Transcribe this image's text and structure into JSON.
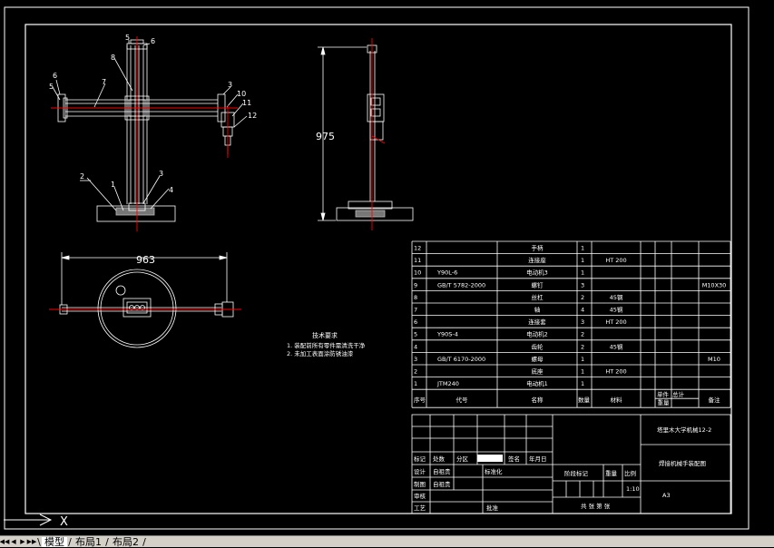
{
  "view_labels": {
    "dim_height": "975",
    "dim_width": "963"
  },
  "balloons": [
    "5",
    "6",
    "8",
    "7",
    "6",
    "5",
    "3",
    "10",
    "11",
    "12",
    "2",
    "1",
    "3",
    "4"
  ],
  "tech_notes": {
    "title": "技术要求",
    "lines": [
      "1. 装配前所有零件需清洗干净",
      "2. 未加工表面涂防锈油漆"
    ]
  },
  "bom": {
    "rows": [
      {
        "no": "12",
        "code": "",
        "name": "手柄",
        "qty": "1",
        "mat": "",
        "note": ""
      },
      {
        "no": "11",
        "code": "",
        "name": "连接座",
        "qty": "1",
        "mat": "HT 200",
        "note": ""
      },
      {
        "no": "10",
        "code": "Y90L-6",
        "name": "电动机3",
        "qty": "1",
        "mat": "",
        "note": ""
      },
      {
        "no": "9",
        "code": "GB/T 5782-2000",
        "name": "螺钉",
        "qty": "3",
        "mat": "",
        "note": "M10X30"
      },
      {
        "no": "8",
        "code": "",
        "name": "丝杠",
        "qty": "2",
        "mat": "45钢",
        "note": ""
      },
      {
        "no": "7",
        "code": "",
        "name": "轴",
        "qty": "4",
        "mat": "45钢",
        "note": ""
      },
      {
        "no": "6",
        "code": "",
        "name": "连接套",
        "qty": "3",
        "mat": "HT 200",
        "note": ""
      },
      {
        "no": "5",
        "code": "Y90S-4",
        "name": "电动机2",
        "qty": "2",
        "mat": "",
        "note": ""
      },
      {
        "no": "4",
        "code": "",
        "name": "齿轮",
        "qty": "2",
        "mat": "45钢",
        "note": ""
      },
      {
        "no": "3",
        "code": "GB/T 6170-2000",
        "name": "螺母",
        "qty": "1",
        "mat": "",
        "note": "M10"
      },
      {
        "no": "2",
        "code": "",
        "name": "底座",
        "qty": "1",
        "mat": "HT 200",
        "note": ""
      },
      {
        "no": "1",
        "code": "JTM240",
        "name": "电动机1",
        "qty": "1",
        "mat": "",
        "note": ""
      }
    ],
    "header": {
      "no": "序号",
      "code": "代号",
      "name": "名称",
      "qty": "数量",
      "mat": "材料",
      "unit_w": "单件",
      "total_w": "总计",
      "weight": "重量",
      "note": "备注"
    }
  },
  "title_block": {
    "school": "塔里木大学机械12-2",
    "drawing_name": "焊接机械手装配图",
    "paper": "A3",
    "scale": "1:10",
    "mark": "标记",
    "count": "处数",
    "zone": "分区",
    "doc_no": "更改文件号",
    "sign": "签名",
    "date": "年月日",
    "design": "设计",
    "design_who": "自祖贵",
    "standard": "标准化",
    "stage": "阶段标记",
    "weight": "重量",
    "ratio": "比例",
    "draw": "制图",
    "draw_who": "自祖贵",
    "review": "审核",
    "craft": "工艺",
    "approve": "批准",
    "sheets": "共 张 第 张"
  },
  "ucs": {
    "axis_label": "X"
  },
  "tabs": {
    "model": "模型",
    "layout1": "布局1",
    "layout2": "布局2"
  }
}
